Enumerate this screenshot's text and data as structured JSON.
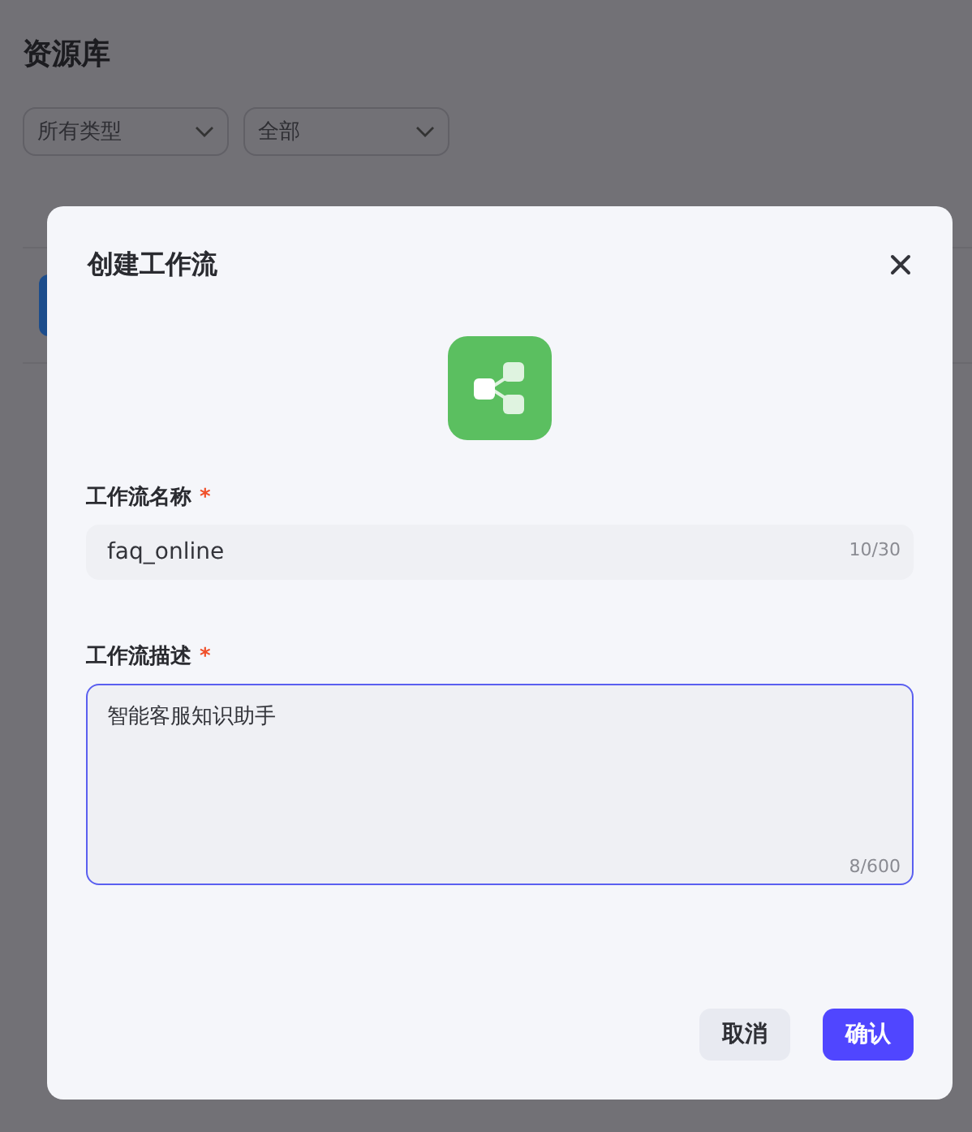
{
  "page": {
    "title": "资源库",
    "filters": [
      {
        "label": "所有类型"
      },
      {
        "label": "全部"
      }
    ]
  },
  "dialog": {
    "title": "创建工作流",
    "fields": [
      {
        "kind": "input",
        "label": "工作流名称",
        "required_mark": "*",
        "value": "faq_online",
        "counter": "10/30",
        "focused": false
      },
      {
        "kind": "textarea",
        "label": "工作流描述",
        "required_mark": "*",
        "value": "智能客服知识助手",
        "counter": "8/600",
        "focused": true
      }
    ],
    "buttons": [
      {
        "label": "取消",
        "kind": "secondary"
      },
      {
        "label": "确认",
        "kind": "primary"
      }
    ]
  }
}
